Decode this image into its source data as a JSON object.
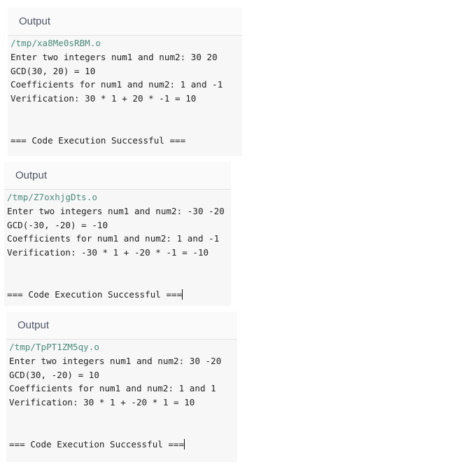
{
  "colors": {
    "background": "#ffffff",
    "panel_bg": "#f7f7f8",
    "header_text": "#4d5564",
    "path_text": "#4b8a7a",
    "output_text": "#1f1f1f"
  },
  "panels": [
    {
      "header": "Output",
      "path": "/tmp/xa8Me0sRBM.o",
      "lines": [
        "Enter two integers num1 and num2: 30 20",
        "GCD(30, 20) = 10",
        "Coefficients for num1 and num2: 1 and -1",
        "Verification: 30 * 1 + 20 * -1 = 10"
      ],
      "status": "=== Code Execution Successful ===",
      "cursor": false
    },
    {
      "header": "Output",
      "path": "/tmp/Z7oxhjgDts.o",
      "lines": [
        "Enter two integers num1 and num2: -30 -20",
        "GCD(-30, -20) = -10",
        "Coefficients for num1 and num2: 1 and -1",
        "Verification: -30 * 1 + -20 * -1 = -10"
      ],
      "status": "=== Code Execution Successful ===",
      "cursor": true
    },
    {
      "header": "Output",
      "path": "/tmp/TpPT1ZM5qy.o",
      "lines": [
        "Enter two integers num1 and num2: 30 -20",
        "GCD(30, -20) = 10",
        "Coefficients for num1 and num2: 1 and 1",
        "Verification: 30 * 1 + -20 * 1 = 10"
      ],
      "status": "=== Code Execution Successful ===",
      "cursor": true
    }
  ]
}
